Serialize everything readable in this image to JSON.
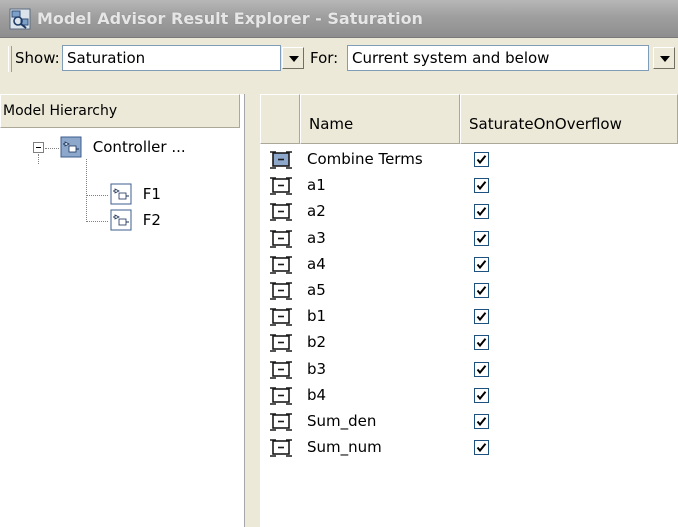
{
  "window": {
    "title": "Model Advisor Result Explorer - Saturation"
  },
  "toolbar": {
    "show_label": "Show:",
    "show_value": "Saturation",
    "for_label": "For:",
    "for_value": "Current system and below"
  },
  "tree": {
    "header": "Model Hierarchy",
    "root": {
      "label": "Controller ...",
      "expanded": true
    },
    "children": [
      {
        "label": "F1"
      },
      {
        "label": "F2"
      }
    ]
  },
  "table": {
    "columns": [
      "",
      "Name",
      "SaturateOnOverflow"
    ],
    "rows": [
      {
        "name": "Combine Terms",
        "saturate": true
      },
      {
        "name": "a1",
        "saturate": true
      },
      {
        "name": "a2",
        "saturate": true
      },
      {
        "name": "a3",
        "saturate": true
      },
      {
        "name": "a4",
        "saturate": true
      },
      {
        "name": "a5",
        "saturate": true
      },
      {
        "name": "b1",
        "saturate": true
      },
      {
        "name": "b2",
        "saturate": true
      },
      {
        "name": "b3",
        "saturate": true
      },
      {
        "name": "b4",
        "saturate": true
      },
      {
        "name": "Sum_den",
        "saturate": true
      },
      {
        "name": "Sum_num",
        "saturate": true
      }
    ]
  },
  "icons": {
    "app": "model-advisor-icon",
    "subsystem": "subsystem-block-icon",
    "block": "sum-block-icon",
    "dropdown": "chevron-down-icon"
  }
}
